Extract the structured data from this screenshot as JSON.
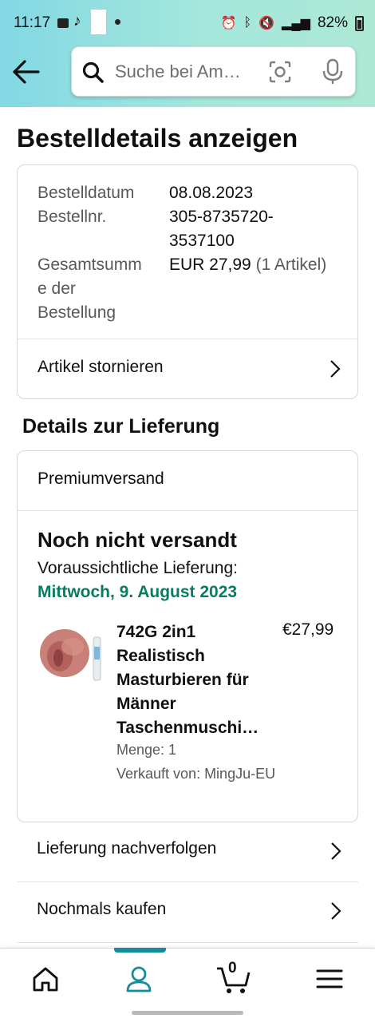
{
  "status_bar": {
    "time": "11:17",
    "battery": "82%",
    "app_icon": "tiktok-icon"
  },
  "search": {
    "placeholder": "Suche bei Am…"
  },
  "page_title": "Bestelldetails anzeigen",
  "order": {
    "date_label": "Bestelldatum",
    "date_value": "08.08.2023",
    "number_label": "Bestellnr.",
    "number_value_line1": "305-8735720-",
    "number_value_line2": "3537100",
    "total_label_line1": "Gesamtsumm",
    "total_label_line2": "e der",
    "total_label_line3": "Bestellung",
    "total_value": "EUR 27,99",
    "total_items": "(1 Artikel)",
    "cancel_label": "Artikel stornieren"
  },
  "delivery": {
    "heading": "Details zur Lieferung",
    "shipping_method": "Premiumversand",
    "status": "Noch nicht versandt",
    "eta_label": "Voraussichtliche Lieferung:",
    "eta_date": "Mittwoch, 9. August 2023",
    "eta_color": "#067d62"
  },
  "product": {
    "name_line1": "742G 2in1",
    "name_line2": "Realistisch",
    "name_line3": "Masturbieren für",
    "name_line4": "Männer",
    "name_line5": "Taschenmuschi…",
    "price": "€27,99",
    "quantity": "Menge: 1",
    "seller": "Verkauft von: MingJu-EU"
  },
  "actions": {
    "track": "Lieferung nachverfolgen",
    "buy_again": "Nochmals kaufen"
  },
  "bottom_nav": {
    "items": [
      "home-icon",
      "account-icon",
      "cart-icon",
      "menu-icon"
    ],
    "cart_count": "0",
    "active": "account-icon",
    "accent": "#138d9b"
  }
}
